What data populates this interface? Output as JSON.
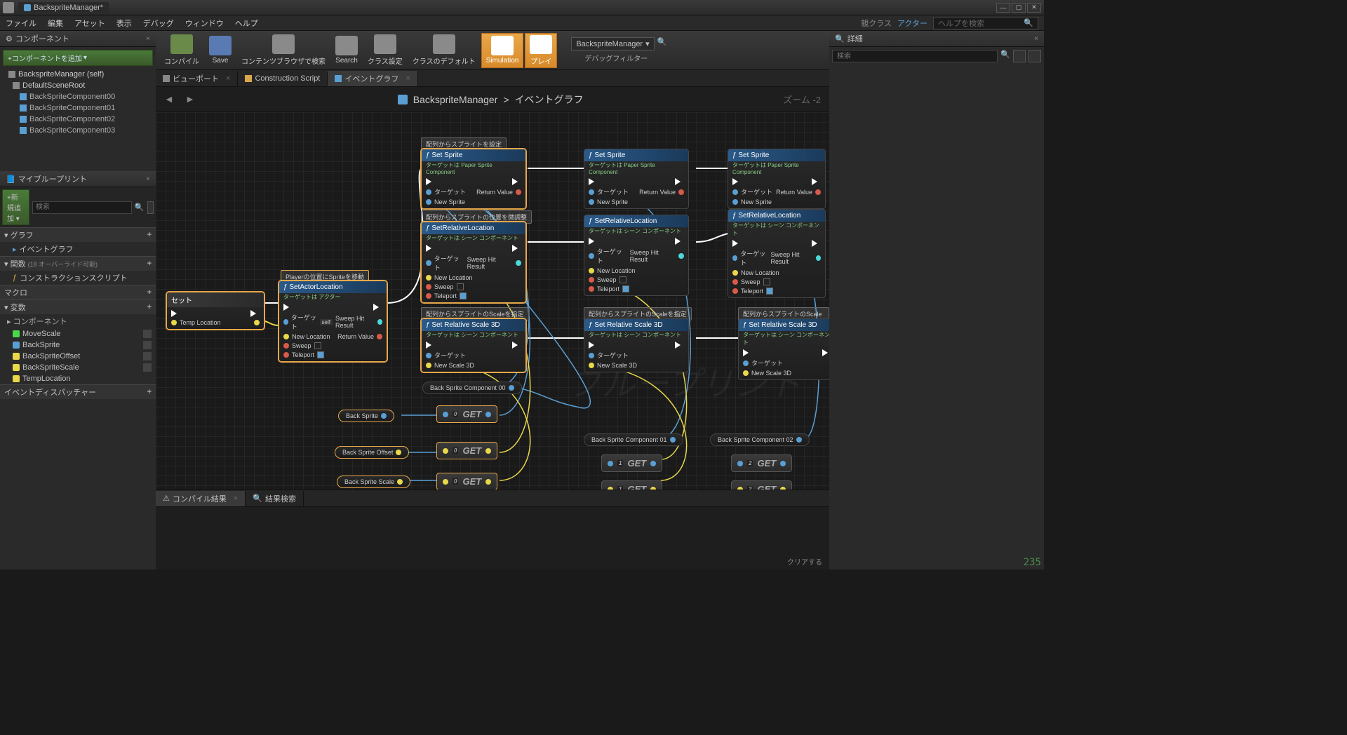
{
  "titlebar": {
    "tab": "BackspriteManager*"
  },
  "menubar": {
    "items": [
      "ファイル",
      "編集",
      "アセット",
      "表示",
      "デバッグ",
      "ウィンドウ",
      "ヘルプ"
    ],
    "parent_class_label": "親クラス",
    "parent_class": "アクター",
    "search_placeholder": "ヘルプを検索"
  },
  "toolbar": {
    "compile": "コンパイル",
    "save": "Save",
    "browse": "コンテンツブラウザで検索",
    "search": "Search",
    "class_settings": "クラス設定",
    "class_defaults": "クラスのデフォルト",
    "simulation": "Simulation",
    "play": "プレイ",
    "combo": "BackspriteManager",
    "debug_filter": "デバッグフィルター"
  },
  "components": {
    "title": "コンポーネント",
    "add_btn": "+コンポーネントを追加",
    "self": "BackspriteManager (self)",
    "root": "DefaultSceneRoot",
    "children": [
      "BackSpriteComponent00",
      "BackSpriteComponent01",
      "BackSpriteComponent02",
      "BackSpriteComponent03"
    ]
  },
  "myblueprint": {
    "title": "マイブループリント",
    "add_btn": "+新規追加",
    "search_placeholder": "検索",
    "cat_graph": "グラフ",
    "event_graph": "イベントグラフ",
    "cat_functions": "関数",
    "functions_note": "(18 オーバーライド可能)",
    "construction_script": "コンストラクションスクリプト",
    "cat_macros": "マクロ",
    "cat_variables": "変数",
    "cat_components": "コンポーネント",
    "vars": [
      {
        "name": "MoveScale",
        "color": "#4ad84a"
      },
      {
        "name": "BackSprite",
        "color": "#5a9fd4"
      },
      {
        "name": "BackSpriteOffset",
        "color": "#e8d84a"
      },
      {
        "name": "BackSpriteScale",
        "color": "#e8d84a"
      },
      {
        "name": "TempLocation",
        "color": "#e8d84a"
      }
    ],
    "cat_dispatchers": "イベントディスパッチャー"
  },
  "graph_tabs": {
    "viewport": "ビューポート",
    "construction": "Construction Script",
    "event_graph": "イベントグラフ"
  },
  "breadcrumb": {
    "root": "BackspriteManager",
    "sep": ">",
    "leaf": "イベントグラフ",
    "zoom": "ズーム -2"
  },
  "comments": {
    "c1": "配列からスプライトを設定",
    "c2": "配列からスプライトの位置を微調整",
    "c3": "配列からスプライトのScaleを指定",
    "c4": "Playerの位置にSpriteを移動"
  },
  "nodes": {
    "set": {
      "title": "セット",
      "pin1": "Temp Location"
    },
    "set_actor_loc": {
      "title": "SetActorLocation",
      "sub": "ターゲットは アクター",
      "target": "ターゲット",
      "self_val": "self",
      "new_loc": "New Location",
      "sweep": "Sweep",
      "teleport": "Teleport",
      "hit": "Sweep Hit Result",
      "ret": "Return Value"
    },
    "set_sprite": {
      "title": "Set Sprite",
      "sub": "ターゲットは Paper Sprite Component",
      "target": "ターゲット",
      "new_sprite": "New Sprite",
      "ret": "Return Value"
    },
    "set_rel_loc": {
      "title": "SetRelativeLocation",
      "sub": "ターゲットは シーン コンポーネント",
      "target": "ターゲット",
      "new_loc": "New Location",
      "sweep": "Sweep",
      "teleport": "Teleport",
      "hit": "Sweep Hit Result"
    },
    "set_rel_scale": {
      "title": "Set Relative Scale 3D",
      "sub": "ターゲットは シーン コンポーネント",
      "target": "ターゲット",
      "new_scale": "New Scale 3D"
    },
    "get": "GET"
  },
  "var_pills": {
    "back_sprite": "Back Sprite",
    "back_sprite_offset": "Back Sprite Offset",
    "back_sprite_scale": "Back Sprite Scale",
    "comp00": "Back Sprite Component 00",
    "comp01": "Back Sprite Component 01",
    "comp02": "Back Sprite Component 02"
  },
  "details": {
    "title": "詳細",
    "search_placeholder": "検索"
  },
  "bottom_tabs": {
    "compile_results": "コンパイル結果",
    "find_results": "結果検索",
    "clear": "クリアする"
  },
  "counter": "235"
}
